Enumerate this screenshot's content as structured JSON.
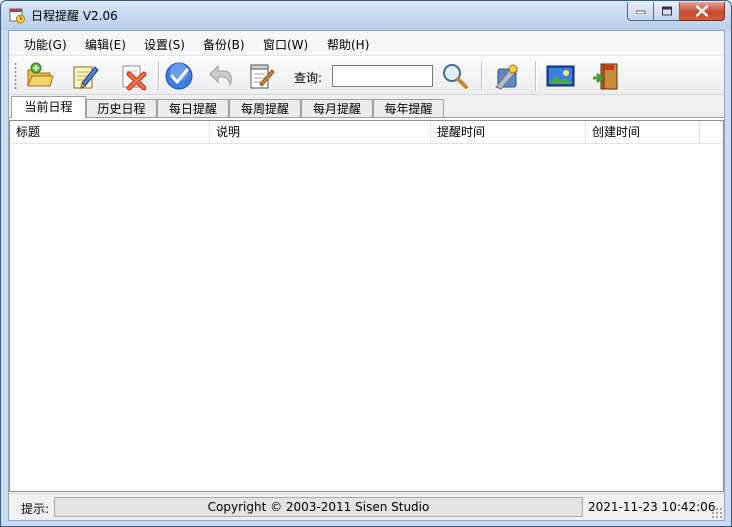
{
  "window": {
    "title": "日程提醒 V2.06"
  },
  "menu": [
    "功能(G)",
    "编辑(E)",
    "设置(S)",
    "备份(B)",
    "窗口(W)",
    "帮助(H)"
  ],
  "toolbar": {
    "buttons": [
      "open-folder-icon",
      "edit-note-icon",
      "delete-icon",
      "check-icon",
      "undo-icon",
      "notepad-icon",
      "settings-icon",
      "screen-icon",
      "exit-icon"
    ],
    "search_label": "查询:",
    "search_value": "",
    "search_placeholder": ""
  },
  "tabs": [
    "当前日程",
    "历史日程",
    "每日提醒",
    "每周提醒",
    "每月提醒",
    "每年提醒"
  ],
  "active_tab": "当前日程",
  "list": {
    "columns": [
      "标题",
      "说明",
      "提醒时间",
      "创建时间"
    ],
    "rows": []
  },
  "status": {
    "label": "提示:",
    "message": "Copyright © 2003-2011 Sisen Studio",
    "datetime": "2021-11-23 10:42:06"
  },
  "colors": {
    "titlebar": "#c5d9f0",
    "close_button": "#c5492f",
    "client_bg": "#f0f0f0"
  }
}
